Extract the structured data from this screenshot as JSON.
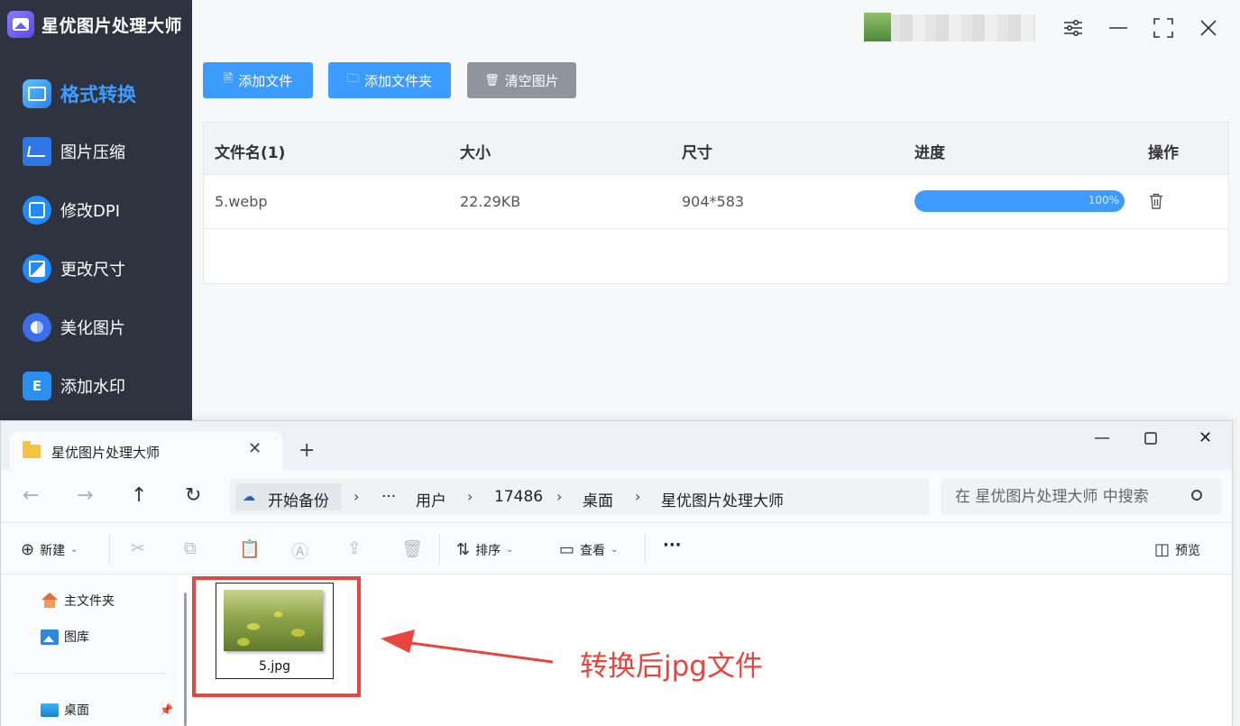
{
  "app": {
    "title": "星优图片处理大师",
    "sidebar": [
      {
        "label": "格式转换",
        "icon": "image-convert-icon",
        "active": true
      },
      {
        "label": "图片压缩",
        "icon": "compress-chart-icon"
      },
      {
        "label": "修改DPI",
        "icon": "dpi-icon"
      },
      {
        "label": "更改尺寸",
        "icon": "resize-icon"
      },
      {
        "label": "美化图片",
        "icon": "beautify-icon"
      },
      {
        "label": "添加水印",
        "icon": "watermark-icon",
        "glyph": "E"
      }
    ],
    "toolbar": {
      "add_file": "添加文件",
      "add_folder": "添加文件夹",
      "clear": "清空图片"
    },
    "table": {
      "headers": [
        "文件名(1)",
        "大小",
        "尺寸",
        "进度",
        "操作"
      ],
      "rows": [
        {
          "name": "5.webp",
          "size": "22.29KB",
          "dimensions": "904*583",
          "progress": 1.0,
          "progress_text": "100%"
        }
      ]
    },
    "colors": {
      "accent": "#3f9bff",
      "sidebar": "#2e3340"
    }
  },
  "explorer": {
    "tab_title": "星优图片处理大师",
    "breadcrumb": [
      "开始备份",
      "···",
      "用户",
      "17486",
      "桌面",
      "星优图片处理大师"
    ],
    "search_placeholder": "在 星优图片处理大师 中搜索",
    "commands": {
      "new": "新建",
      "sort": "排序",
      "view": "查看",
      "more": "···",
      "preview": "预览"
    },
    "nav_pane": [
      "主文件夹",
      "图库",
      "桌面"
    ],
    "files": [
      {
        "name": "5.jpg"
      }
    ]
  },
  "annotation": {
    "text": "转换后jpg文件",
    "color": "#e9443e"
  }
}
